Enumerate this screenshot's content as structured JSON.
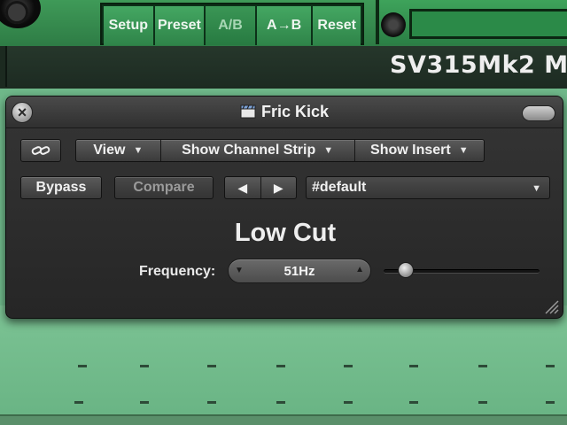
{
  "host": {
    "preset_bar": [
      "Setup",
      "Preset",
      "A/B",
      "A→B",
      "Reset"
    ],
    "plugin_name": "SV315Mk2 M"
  },
  "window": {
    "title": "Fric Kick",
    "menus": {
      "view": "View",
      "channel_strip": "Show Channel Strip",
      "insert": "Show Insert"
    },
    "bypass": "Bypass",
    "compare": "Compare",
    "prev_glyph": "◀",
    "next_glyph": "▶",
    "preset": "#default",
    "section_title": "Low Cut",
    "frequency": {
      "label": "Frequency:",
      "value": "51Hz",
      "slider_fraction": 0.14
    }
  },
  "icons": {
    "close": "close-icon",
    "link": "link-icon",
    "title": "clapperboard-icon",
    "resize": "resize-grip-icon"
  },
  "colors": {
    "host_green": "#3f9a58",
    "window_bg": "#2e2e2e",
    "text": "#f0f0f0"
  }
}
